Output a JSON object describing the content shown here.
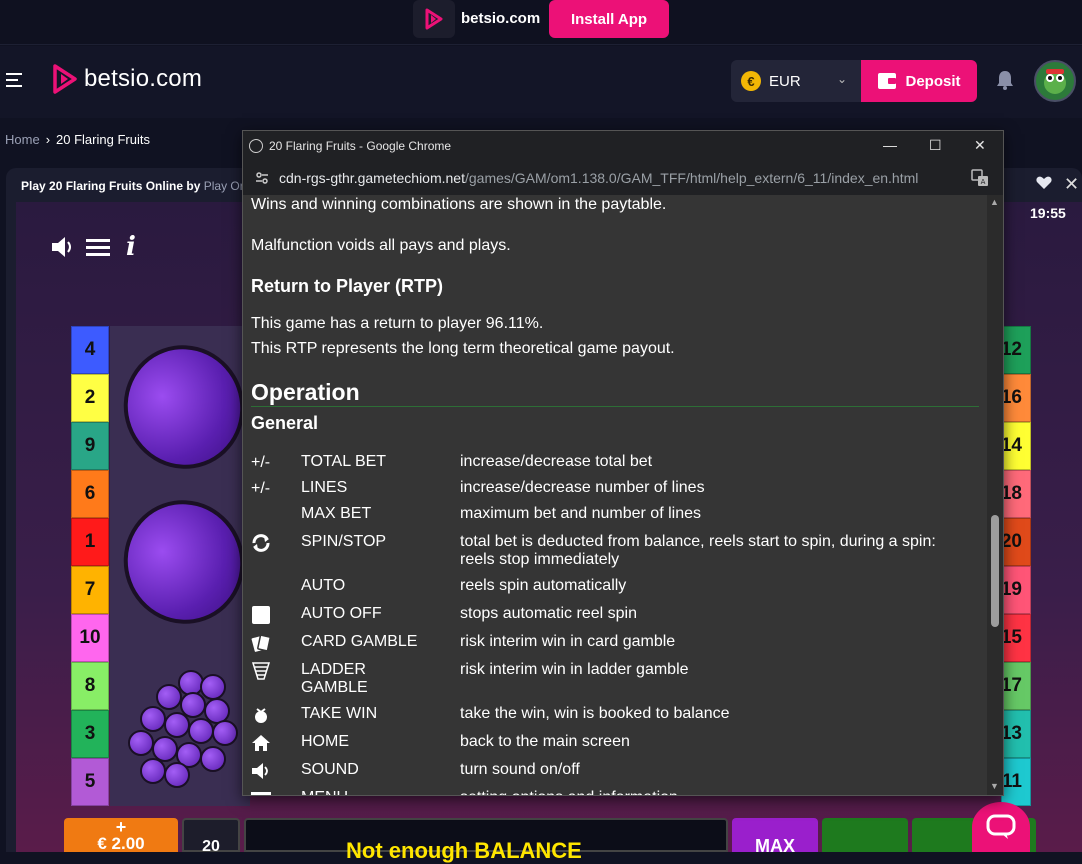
{
  "promo": {
    "site": "betsio.com",
    "install_label": "Install App"
  },
  "header": {
    "logo_text": "betsio.com",
    "currency": "EUR",
    "currency_symbol": "€",
    "deposit_label": "Deposit"
  },
  "breadcrumb": {
    "home": "Home",
    "current": "20 Flaring Fruits"
  },
  "game": {
    "title_bold": "Play 20 Flaring Fruits Online by",
    "title_by": "Play Or",
    "clock": "19:55",
    "left_lines": [
      {
        "n": "4",
        "color": "#3d5bff"
      },
      {
        "n": "2",
        "color": "#ffff44"
      },
      {
        "n": "9",
        "color": "#29a687"
      },
      {
        "n": "6",
        "color": "#ff7a1a"
      },
      {
        "n": "1",
        "color": "#ff1a1a"
      },
      {
        "n": "7",
        "color": "#ffb300"
      },
      {
        "n": "10",
        "color": "#ff66ee"
      },
      {
        "n": "8",
        "color": "#88ee66"
      },
      {
        "n": "3",
        "color": "#22b35a"
      },
      {
        "n": "5",
        "color": "#b25ad6"
      }
    ],
    "right_lines": [
      {
        "n": "12",
        "color": "#1ea05a"
      },
      {
        "n": "16",
        "color": "#ff8a3a"
      },
      {
        "n": "14",
        "color": "#ffff33"
      },
      {
        "n": "18",
        "color": "#ff6a7a"
      },
      {
        "n": "20",
        "color": "#e04a1a"
      },
      {
        "n": "19",
        "color": "#ff5577"
      },
      {
        "n": "15",
        "color": "#ff3344"
      },
      {
        "n": "17",
        "color": "#66c966"
      },
      {
        "n": "13",
        "color": "#22bfae"
      },
      {
        "n": "11",
        "color": "#1ec9d0"
      }
    ],
    "bottom_bet": "+",
    "bottom_bet_value": "€ 2.00",
    "bottom_lines": "20",
    "bottom_message": "Not enough BALANCE",
    "bottom_max": "MAX"
  },
  "popup": {
    "window_title": "20 Flaring Fruits - Google Chrome",
    "url_host": "cdn-rgs-gthr.gametechiom.net",
    "url_path": "/games/GAM/om1.138.0/GAM_TFF/html/help_extern/6_11/index_en.html",
    "p1": "Wins and winning combinations are shown in the paytable.",
    "p2": "Malfunction voids all pays and plays.",
    "rtp_heading": "Return to Player (RTP)",
    "rtp1": "This game has a return to player 96.11%.",
    "rtp2": "This RTP represents the long term theoretical game payout.",
    "operation_heading": "Operation",
    "general_heading": "General",
    "rows": [
      {
        "icon": "+/-",
        "key": "TOTAL BET",
        "value": "increase/decrease total bet"
      },
      {
        "icon": "+/-",
        "key": "LINES",
        "value": "increase/decrease number of lines"
      },
      {
        "icon": "",
        "key": "MAX BET",
        "value": "maximum bet and number of lines"
      },
      {
        "icon": "spin-icon",
        "key": "SPIN/STOP",
        "value": "total bet is deducted from balance, reels start to spin, during a spin: reels stop immediately"
      },
      {
        "icon": "",
        "key": "AUTO",
        "value": "reels spin automatically"
      },
      {
        "icon": "square-icon",
        "key": "AUTO OFF",
        "value": "stops automatic reel spin"
      },
      {
        "icon": "cards-icon",
        "key": "CARD GAMBLE",
        "value": "risk interim win in card gamble"
      },
      {
        "icon": "ladder-icon",
        "key": "LADDER GAMBLE",
        "value": "risk interim win in ladder gamble"
      },
      {
        "icon": "take-win-icon",
        "key": "TAKE WIN",
        "value": "take the win, win is booked to balance"
      },
      {
        "icon": "home-icon",
        "key": "HOME",
        "value": "back to the main screen"
      },
      {
        "icon": "speaker-icon",
        "key": "SOUND",
        "value": "turn sound on/off"
      },
      {
        "icon": "menu-icon",
        "key": "MENU",
        "value": "setting options and information"
      }
    ]
  }
}
